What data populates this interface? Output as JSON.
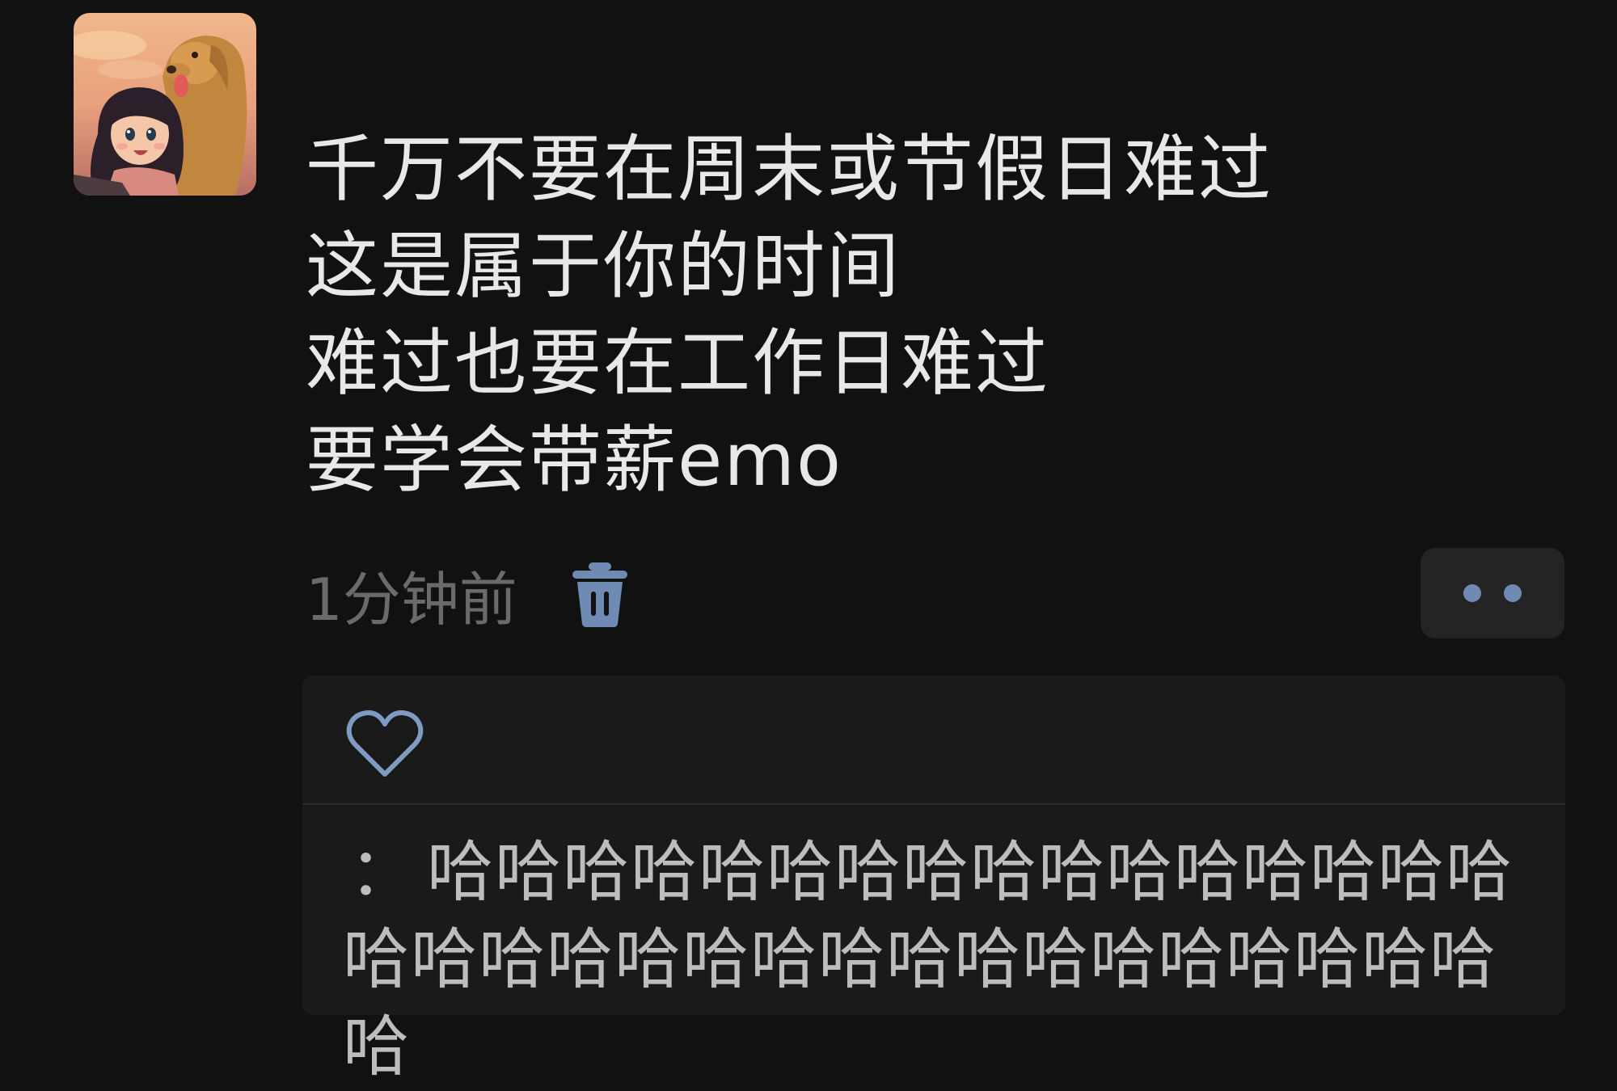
{
  "post": {
    "avatar_icon": "avatar-girl-with-dog-illustration",
    "lines": [
      "千万不要在周末或节假日难过",
      "这是属于你的时间",
      "难过也要在工作日难过",
      "要学会带薪emo"
    ],
    "timestamp": "1分钟前",
    "delete_icon": "trash-icon",
    "more_icon": "more-dots-icon"
  },
  "reply_panel": {
    "like_icon": "heart-outline-icon",
    "comment_separator": "：",
    "comment_text": "哈哈哈哈哈哈哈哈哈哈哈哈哈哈哈哈哈哈哈哈哈哈哈哈哈哈哈哈哈哈哈哈哈哈"
  },
  "colors": {
    "background": "#111111",
    "panel": "#1a1a1a",
    "accent_icon": "#6f8bb3",
    "timestamp": "#6a6a6a"
  }
}
